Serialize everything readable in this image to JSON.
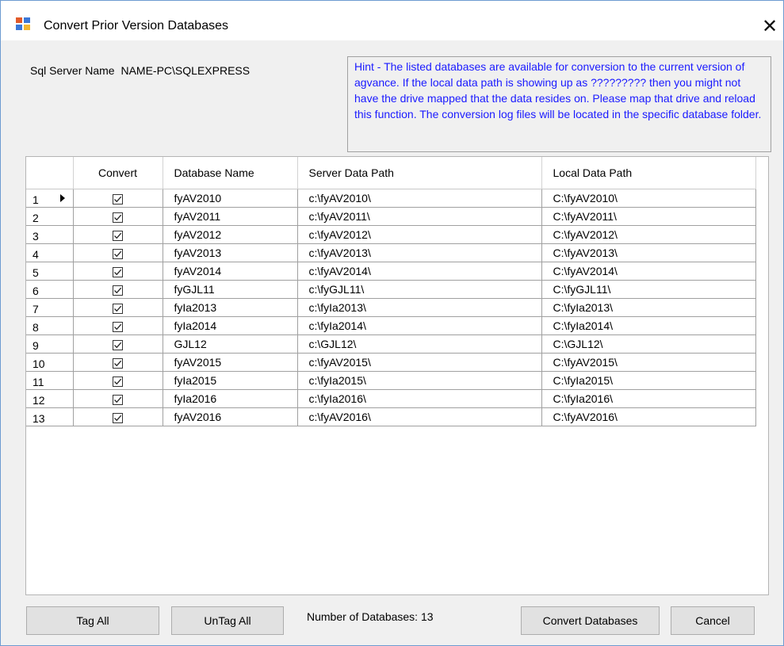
{
  "window": {
    "title": "Convert Prior Version Databases",
    "close_glyph": "✕"
  },
  "server": {
    "label": "Sql Server Name",
    "value": "NAME-PC\\SQLEXPRESS"
  },
  "hint": {
    "text": "Hint - The listed databases are available for conversion to the current version of agvance.  If the local data path is showing up as ????????? then you might not have the drive mapped that the data resides on.  Please map that drive and reload this function.  The conversion log files will be located in the specific database folder."
  },
  "grid": {
    "columns": [
      "Convert",
      "Database Name",
      "Server Data Path",
      "Local Data Path"
    ],
    "rows": [
      {
        "num": "1",
        "convert": true,
        "name": "fyAV2010",
        "server": "c:\\fyAV2010\\",
        "local": "C:\\fyAV2010\\"
      },
      {
        "num": "2",
        "convert": true,
        "name": "fyAV2011",
        "server": "c:\\fyAV2011\\",
        "local": "C:\\fyAV2011\\"
      },
      {
        "num": "3",
        "convert": true,
        "name": "fyAV2012",
        "server": "c:\\fyAV2012\\",
        "local": "C:\\fyAV2012\\"
      },
      {
        "num": "4",
        "convert": true,
        "name": "fyAV2013",
        "server": "c:\\fyAV2013\\",
        "local": "C:\\fyAV2013\\"
      },
      {
        "num": "5",
        "convert": true,
        "name": "fyAV2014",
        "server": "c:\\fyAV2014\\",
        "local": "C:\\fyAV2014\\"
      },
      {
        "num": "6",
        "convert": true,
        "name": "fyGJL11",
        "server": "c:\\fyGJL11\\",
        "local": "C:\\fyGJL11\\"
      },
      {
        "num": "7",
        "convert": true,
        "name": "fyIa2013",
        "server": "c:\\fyIa2013\\",
        "local": "C:\\fyIa2013\\"
      },
      {
        "num": "8",
        "convert": true,
        "name": "fyIa2014",
        "server": "c:\\fyIa2014\\",
        "local": "C:\\fyIa2014\\"
      },
      {
        "num": "9",
        "convert": true,
        "name": "GJL12",
        "server": "c:\\GJL12\\",
        "local": "C:\\GJL12\\"
      },
      {
        "num": "10",
        "convert": true,
        "name": "fyAV2015",
        "server": "c:\\fyAV2015\\",
        "local": "C:\\fyAV2015\\"
      },
      {
        "num": "11",
        "convert": true,
        "name": "fyIa2015",
        "server": "c:\\fyIa2015\\",
        "local": "C:\\fyIa2015\\"
      },
      {
        "num": "12",
        "convert": true,
        "name": "fyIa2016",
        "server": "c:\\fyIa2016\\",
        "local": "C:\\fyIa2016\\"
      },
      {
        "num": "13",
        "convert": true,
        "name": "fyAV2016",
        "server": "c:\\fyAV2016\\",
        "local": "C:\\fyAV2016\\"
      }
    ]
  },
  "footer": {
    "tag_all": "Tag All",
    "untag_all": "UnTag All",
    "count_label": "Number of Databases: 13",
    "convert_button": "Convert Databases",
    "cancel_button": "Cancel"
  },
  "colors": {
    "hint_text": "#1a1aff",
    "window_bg": "#f0f0f0",
    "button_bg": "#e1e1e1"
  }
}
